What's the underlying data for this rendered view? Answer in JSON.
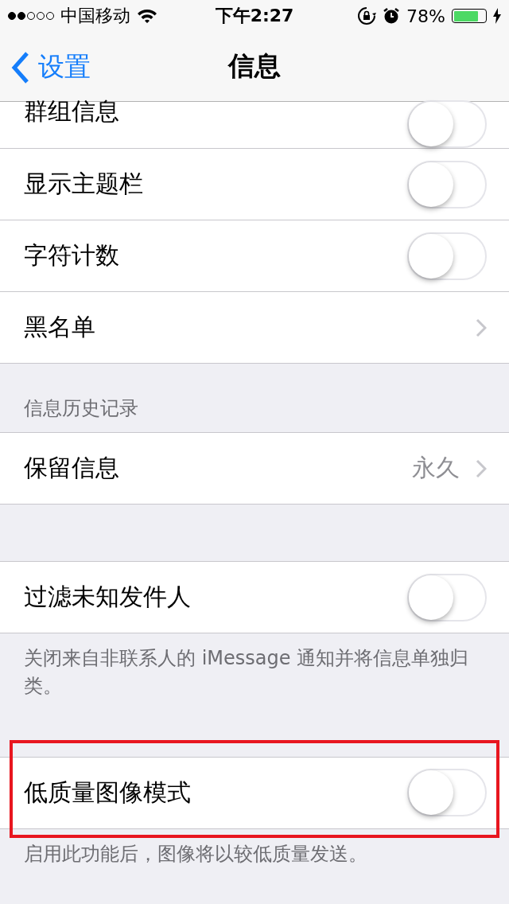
{
  "status_bar": {
    "signal": [
      {
        "filled": true
      },
      {
        "filled": true
      },
      {
        "filled": false
      },
      {
        "filled": false
      },
      {
        "filled": false
      }
    ],
    "carrier": "中国移动",
    "time": "下午2:27",
    "battery_text": "78%",
    "battery": {
      "level": 0.78
    }
  },
  "nav": {
    "back": "设置",
    "title": "信息"
  },
  "sections": [
    {
      "rows": [
        {
          "kind": "toggle",
          "label": "群组信息",
          "on": false,
          "cut": true
        },
        {
          "kind": "toggle",
          "label": "显示主题栏",
          "on": false
        },
        {
          "kind": "toggle",
          "label": "字符计数",
          "on": false
        },
        {
          "kind": "link",
          "label": "黑名单"
        }
      ]
    },
    {
      "header": "信息历史记录",
      "rows": [
        {
          "kind": "link",
          "label": "保留信息",
          "value": "永久"
        }
      ]
    },
    {
      "rows": [
        {
          "kind": "toggle",
          "label": "过滤未知发件人",
          "on": false
        }
      ],
      "footer": "关闭来自非联系人的 iMessage 通知并将信息单独归类。"
    },
    {
      "rows": [
        {
          "kind": "toggle",
          "label": "低质量图像模式",
          "on": false,
          "highlighted": true
        }
      ],
      "footer": "启用此功能后，图像将以较低质量发送。"
    }
  ]
}
